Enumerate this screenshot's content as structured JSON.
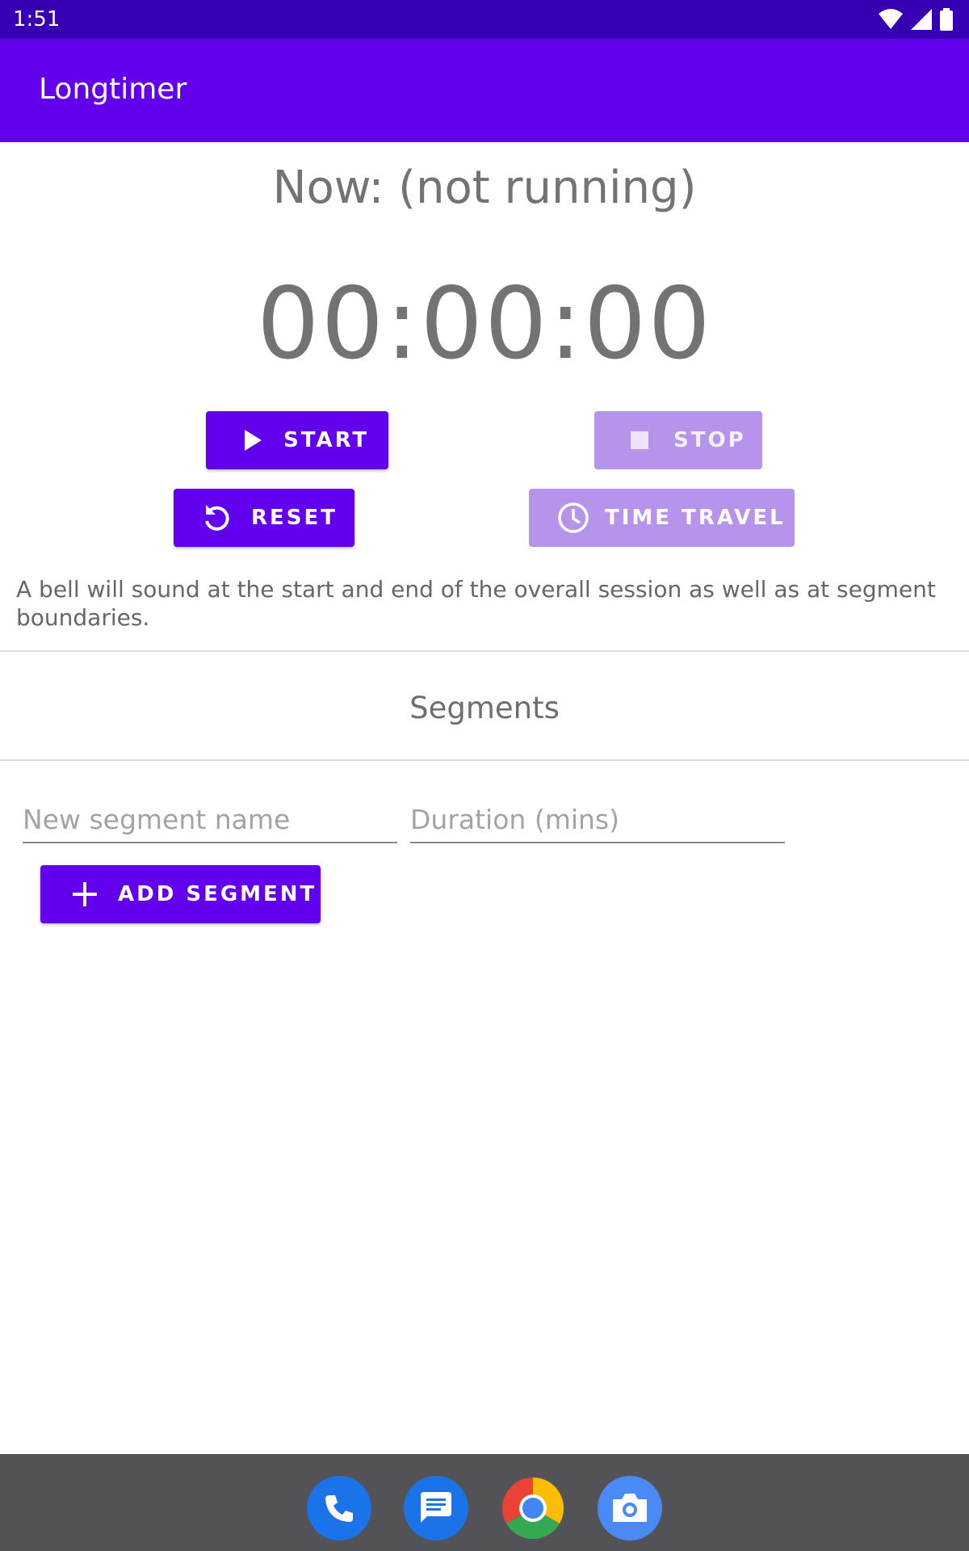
{
  "status_bar": {
    "time": "1:51"
  },
  "app_bar": {
    "title": "Longtimer"
  },
  "now": {
    "text": "Now: (not running)"
  },
  "timer": {
    "display": "00:00:00"
  },
  "buttons": {
    "start": "START",
    "stop": "STOP",
    "reset": "RESET",
    "time_travel": "TIME TRAVEL"
  },
  "info": "A bell will sound at the start and end of the overall session as well as at segment boundaries.",
  "segments": {
    "title": "Segments",
    "name_placeholder": "New segment name",
    "duration_placeholder": "Duration (mins)",
    "add_label": "ADD SEGMENT"
  },
  "colors": {
    "primary": "#6200ee",
    "primary_dark": "#3700b3",
    "disabled": "#b794ec"
  },
  "dock": [
    "phone-icon",
    "messages-icon",
    "chrome-icon",
    "camera-icon"
  ]
}
